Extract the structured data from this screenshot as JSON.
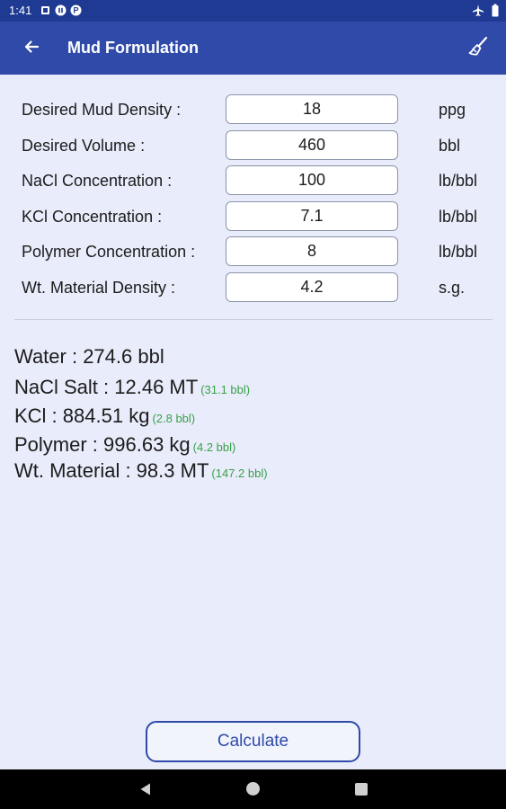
{
  "status_bar": {
    "time": "1:41",
    "left_icons": [
      "square-notification-icon",
      "pause-notification-icon",
      "p-notification-icon"
    ],
    "right_icons": [
      "airplane-mode-icon",
      "battery-icon"
    ]
  },
  "app_bar": {
    "title": "Mud Formulation",
    "back_icon": "arrow-left-icon",
    "clear_icon": "broom-icon"
  },
  "form": {
    "fields": [
      {
        "label": "Desired Mud Density :",
        "value": "18",
        "unit": "ppg"
      },
      {
        "label": "Desired Volume :",
        "value": "460",
        "unit": "bbl"
      },
      {
        "label": "NaCl Concentration :",
        "value": "100",
        "unit": "lb/bbl"
      },
      {
        "label": "KCl Concentration :",
        "value": "7.1",
        "unit": "lb/bbl"
      },
      {
        "label": "Polymer Concentration :",
        "value": "8",
        "unit": "lb/bbl"
      },
      {
        "label": "Wt. Material Density :",
        "value": "4.2",
        "unit": "s.g."
      }
    ]
  },
  "results": [
    {
      "text": "Water : 274.6 bbl",
      "sub": ""
    },
    {
      "text": "NaCl Salt : 12.46 MT",
      "sub": "(31.1 bbl)"
    },
    {
      "text": "KCl : 884.51 kg",
      "sub": "(2.8 bbl)"
    },
    {
      "text": "Polymer : 996.63 kg",
      "sub": "(4.2 bbl)"
    },
    {
      "text": "Wt. Material : 98.3 MT",
      "sub": "(147.2 bbl)"
    }
  ],
  "actions": {
    "calculate_label": "Calculate"
  },
  "nav_bar": {
    "icons": [
      "back-triangle-icon",
      "home-circle-icon",
      "recents-square-icon"
    ]
  },
  "colors": {
    "status_bar": "#1f3a93",
    "app_bar": "#2f4aa8",
    "background": "#e9ecfa",
    "accent": "#2f4aa8",
    "result_sub": "#3aa04a"
  }
}
